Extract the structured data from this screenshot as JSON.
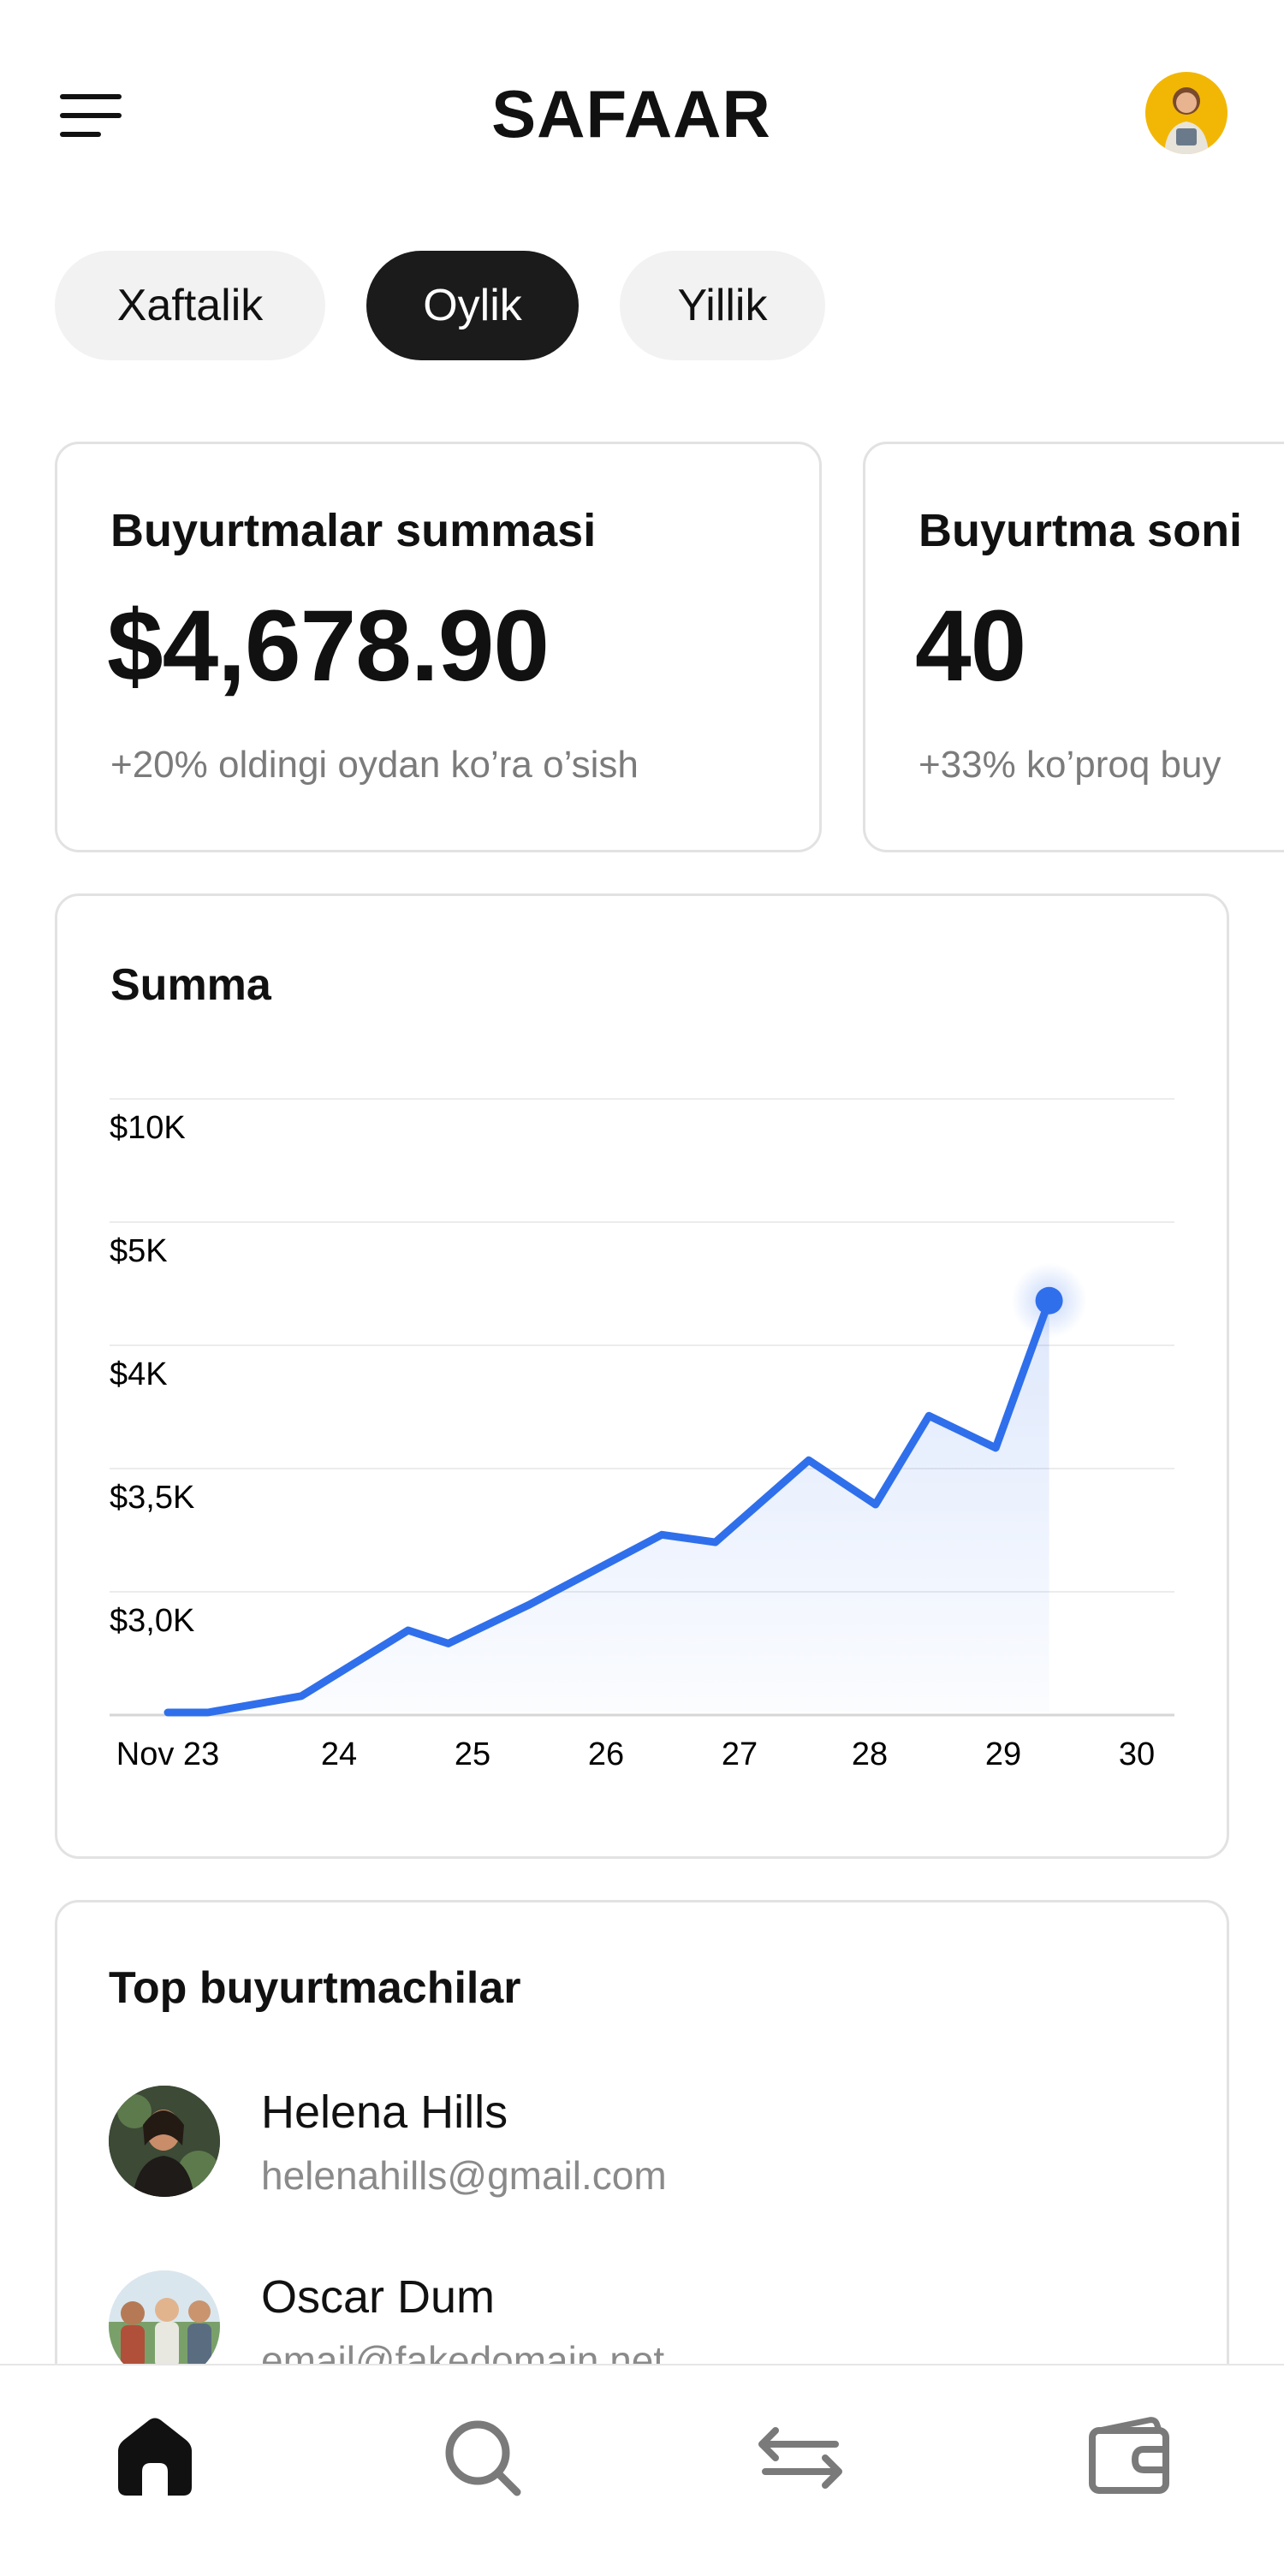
{
  "header": {
    "title": "SAFAAR",
    "menu_icon": "hamburger-menu-icon",
    "avatar": "user-avatar"
  },
  "period_tabs": [
    {
      "label": "Xaftalik",
      "active": false
    },
    {
      "label": "Oylik",
      "active": true
    },
    {
      "label": "Yillik",
      "active": false
    }
  ],
  "stats": [
    {
      "title": "Buyurtmalar summasi",
      "value": "$4,678.90",
      "note": "+20% oldingi oydan ko’ra o’sish"
    },
    {
      "title": "Buyurtma soni",
      "value": "40",
      "note": "+33%  ko’proq buy"
    }
  ],
  "chart": {
    "title": "Summa",
    "accent_color": "#2F6FEB"
  },
  "chart_data": {
    "type": "area",
    "title": "Summa",
    "x_tick_labels": [
      "Nov 23",
      "24",
      "25",
      "26",
      "27",
      "28",
      "29",
      "30"
    ],
    "y_tick_labels": [
      "$10K",
      "$5K",
      "$4K",
      "$3,5K",
      "$3,0K"
    ],
    "series": [
      {
        "x": [
          23.0,
          23.3,
          24.0,
          24.8,
          25.1,
          25.7,
          26.7,
          27.1,
          27.8,
          28.3,
          28.7,
          29.2,
          29.6
        ],
        "y": [
          2500,
          2500,
          2600,
          3000,
          2920,
          3100,
          3380,
          3350,
          3680,
          3500,
          3860,
          3730,
          4650
        ]
      }
    ],
    "highlight_last_point": true,
    "grid": true
  },
  "top_customers": {
    "title": "Top buyurtmachilar",
    "items": [
      {
        "name": "Helena Hills",
        "email": "helenahills@gmail.com"
      },
      {
        "name": "Oscar Dum",
        "email": "email@fakedomain.net"
      }
    ]
  },
  "bottom_nav": [
    {
      "icon": "home-icon",
      "active": true
    },
    {
      "icon": "search-icon",
      "active": false
    },
    {
      "icon": "transfer-arrows-icon",
      "active": false
    },
    {
      "icon": "wallet-icon",
      "active": false
    }
  ],
  "colors": {
    "accent": "#2F6FEB",
    "dark": "#1B1B1B",
    "muted": "#8A8A8A",
    "avatar_bg": "#F2B705"
  }
}
